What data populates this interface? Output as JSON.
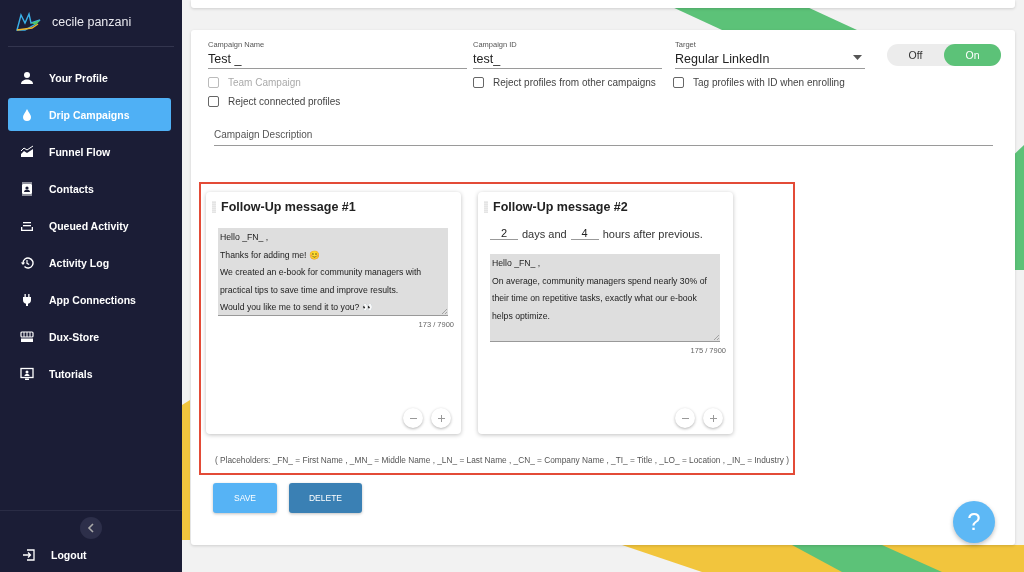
{
  "sidebar": {
    "user": "cecile panzani",
    "items": [
      {
        "label": "Your Profile",
        "kind": "person",
        "selected": false
      },
      {
        "label": "Drip Campaigns",
        "kind": "drop",
        "selected": true
      },
      {
        "label": "Funnel Flow",
        "kind": "chart",
        "selected": false
      },
      {
        "label": "Contacts",
        "kind": "contact",
        "selected": false
      },
      {
        "label": "Queued Activity",
        "kind": "queue",
        "selected": false
      },
      {
        "label": "Activity Log",
        "kind": "history",
        "selected": false
      },
      {
        "label": "App Connections",
        "kind": "plug",
        "selected": false
      },
      {
        "label": "Dux-Store",
        "kind": "store",
        "selected": false
      },
      {
        "label": "Tutorials",
        "kind": "monitor",
        "selected": false
      }
    ],
    "logout": "Logout"
  },
  "campaign": {
    "name_label": "Campaign Name",
    "name": "Test _",
    "id_label": "Campaign ID",
    "id": "test_",
    "target_label": "Target",
    "target": "Regular LinkedIn",
    "toggle": [
      {
        "label": "Off",
        "selected": false
      },
      {
        "label": "On",
        "selected": true
      }
    ],
    "options": [
      {
        "label": "Team Campaign",
        "checked": false,
        "disabled": true
      },
      {
        "label": "Reject profiles from other campaigns",
        "checked": false,
        "disabled": false
      },
      {
        "label": "Tag profiles with ID when enrolling",
        "checked": false,
        "disabled": false
      },
      {
        "label": "Reject connected profiles",
        "checked": false,
        "disabled": false
      }
    ],
    "description_placeholder": "Campaign Description"
  },
  "messages": [
    {
      "title": "Follow-Up message #1",
      "text": "Hello _FN_ ,\nThanks for adding me! 😊\nWe created an e-book for community managers with practical tips to save time and improve results.\nWould you like me to send it to you? 👀",
      "count": "173 / 7900"
    },
    {
      "title": "Follow-Up message #2",
      "delay": {
        "days": "2",
        "days_label": "days and",
        "hours": "4",
        "hours_label": "hours after previous."
      },
      "text": "Hello _FN_ ,\nOn average, community managers spend nearly 30% of their time on repetitive tasks, exactly what our e-book helps optimize.",
      "count": "175 / 7900"
    }
  ],
  "placeholders_note": "( Placeholders: _FN_ = First Name , _MN_ = Middle Name , _LN_ = Last Name , _CN_ = Company Name , _TI_ = Title , _LO_ = Location , _IN_ = Industry )",
  "buttons": [
    {
      "label": "SAVE",
      "kind": "save"
    },
    {
      "label": "DELETE",
      "kind": "delete"
    }
  ],
  "help": "?"
}
